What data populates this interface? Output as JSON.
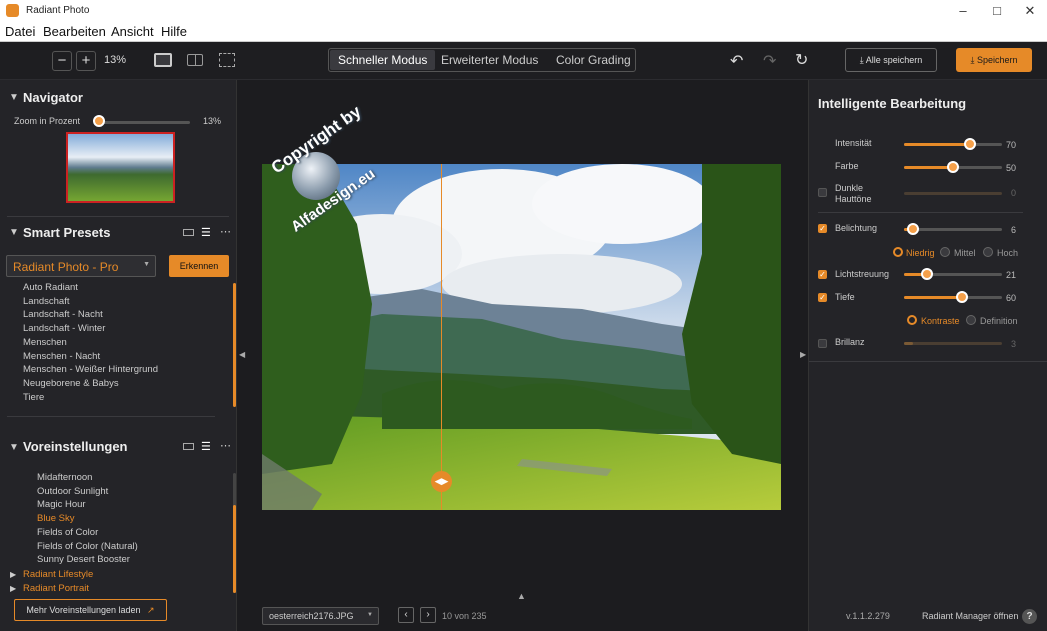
{
  "app": {
    "title": "Radiant Photo",
    "accent": "#e68a28"
  },
  "menu": [
    "Datei",
    "Bearbeiten",
    "Ansicht",
    "Hilfe"
  ],
  "toolbar": {
    "zoom_value": "13%",
    "modes": [
      "Schneller Modus",
      "Erweiterter Modus",
      "Color Grading"
    ],
    "active_mode": "Schneller Modus",
    "save_all_label": "Alle speichern",
    "save_label": "Speichern"
  },
  "navigator": {
    "title": "Navigator",
    "zoom_label": "Zoom in Prozent",
    "zoom_value": "13%",
    "zoom_fraction": 0.13
  },
  "smart_presets": {
    "title": "Smart Presets",
    "selected_package": "Radiant Photo - Pro",
    "recognize_label": "Erkennen",
    "items": [
      "Auto Radiant",
      "Landschaft",
      "Landschaft - Nacht",
      "Landschaft - Winter",
      "Menschen",
      "Menschen - Nacht",
      "Menschen - Weißer Hintergrund",
      "Neugeborene & Babys",
      "Tiere"
    ]
  },
  "presets": {
    "title": "Voreinstellungen",
    "items": [
      {
        "label": "Midafternoon",
        "active": false
      },
      {
        "label": "Outdoor Sunlight",
        "active": false
      },
      {
        "label": "Magic Hour",
        "active": false
      },
      {
        "label": "Blue Sky",
        "active": true
      },
      {
        "label": "Fields of Color",
        "active": false
      },
      {
        "label": "Fields of Color (Natural)",
        "active": false
      },
      {
        "label": "Sunny Desert Booster",
        "active": false
      }
    ],
    "groups": [
      "Radiant Lifestyle",
      "Radiant Portrait"
    ],
    "more_label": "Mehr Voreinstellungen laden"
  },
  "image": {
    "filename": "oesterreich2176.JPG",
    "counter": "10 von 235",
    "watermark_top": "Copyright by",
    "watermark_bottom": "Alfadesign.eu"
  },
  "smart_edit": {
    "title": "Intelligente Bearbeitung",
    "sliders": [
      {
        "label": "Intensität",
        "value": 70,
        "checkbox": null
      },
      {
        "label": "Farbe",
        "value": 50,
        "checkbox": null
      },
      {
        "label": "Dunkle Hauttöne",
        "value": 0,
        "checkbox": false
      },
      {
        "label": "Belichtung",
        "value": 6,
        "checkbox": true
      },
      {
        "label": "Lichtstreuung",
        "value": 21,
        "checkbox": true
      },
      {
        "label": "Tiefe",
        "value": 60,
        "checkbox": true
      },
      {
        "label": "Brillanz",
        "value": 3,
        "checkbox": false
      }
    ],
    "exposure_options": [
      "Niedrig",
      "Mittel",
      "Hoch"
    ],
    "exposure_selected": "Niedrig",
    "depth_options": [
      "Kontraste",
      "Definition"
    ],
    "depth_selected": "Kontraste"
  },
  "footer": {
    "version": "v.1.1.2.279",
    "manager_label": "Radiant Manager öffnen"
  }
}
